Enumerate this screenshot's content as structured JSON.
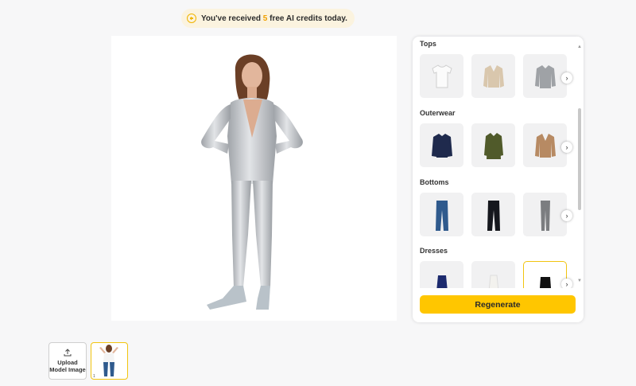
{
  "banner": {
    "icon": "plus-circle-icon",
    "prefix": "You've received",
    "count": "5",
    "suffix": "free AI credits today."
  },
  "panel": {
    "categories": [
      {
        "title": "Tops",
        "items": [
          "white t-shirt",
          "beige cardigan",
          "grey button-up shirt"
        ]
      },
      {
        "title": "Outerwear",
        "items": [
          "navy puffer jacket",
          "olive trench coat",
          "camel blazer"
        ]
      },
      {
        "title": "Bottoms",
        "items": [
          "blue jeans",
          "black trousers",
          "grey leggings"
        ]
      },
      {
        "title": "Dresses",
        "items": [
          "navy dress",
          "white dress",
          "black bodysuit"
        ]
      }
    ],
    "selected_item": "black bodysuit",
    "regenerate_label": "Regenerate"
  },
  "upload": {
    "line1": "Upload",
    "line2": "Model Image",
    "icon": "upload-icon"
  },
  "model_thumb": {
    "index": "1"
  },
  "colors": {
    "accent": "#ffc600",
    "banner_bg": "#fbf3df",
    "selection": "#f1c40f"
  }
}
